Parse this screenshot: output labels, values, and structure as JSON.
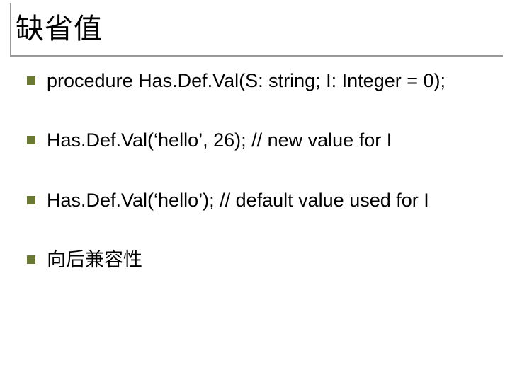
{
  "title": "缺省值",
  "bullets": [
    "procedure Has.Def.Val(S: string; I: Integer = 0);",
    "Has.Def.Val(‘hello’, 26); // new value for I",
    "Has.Def.Val(‘hello’); // default value used for I",
    "向后兼容性"
  ]
}
